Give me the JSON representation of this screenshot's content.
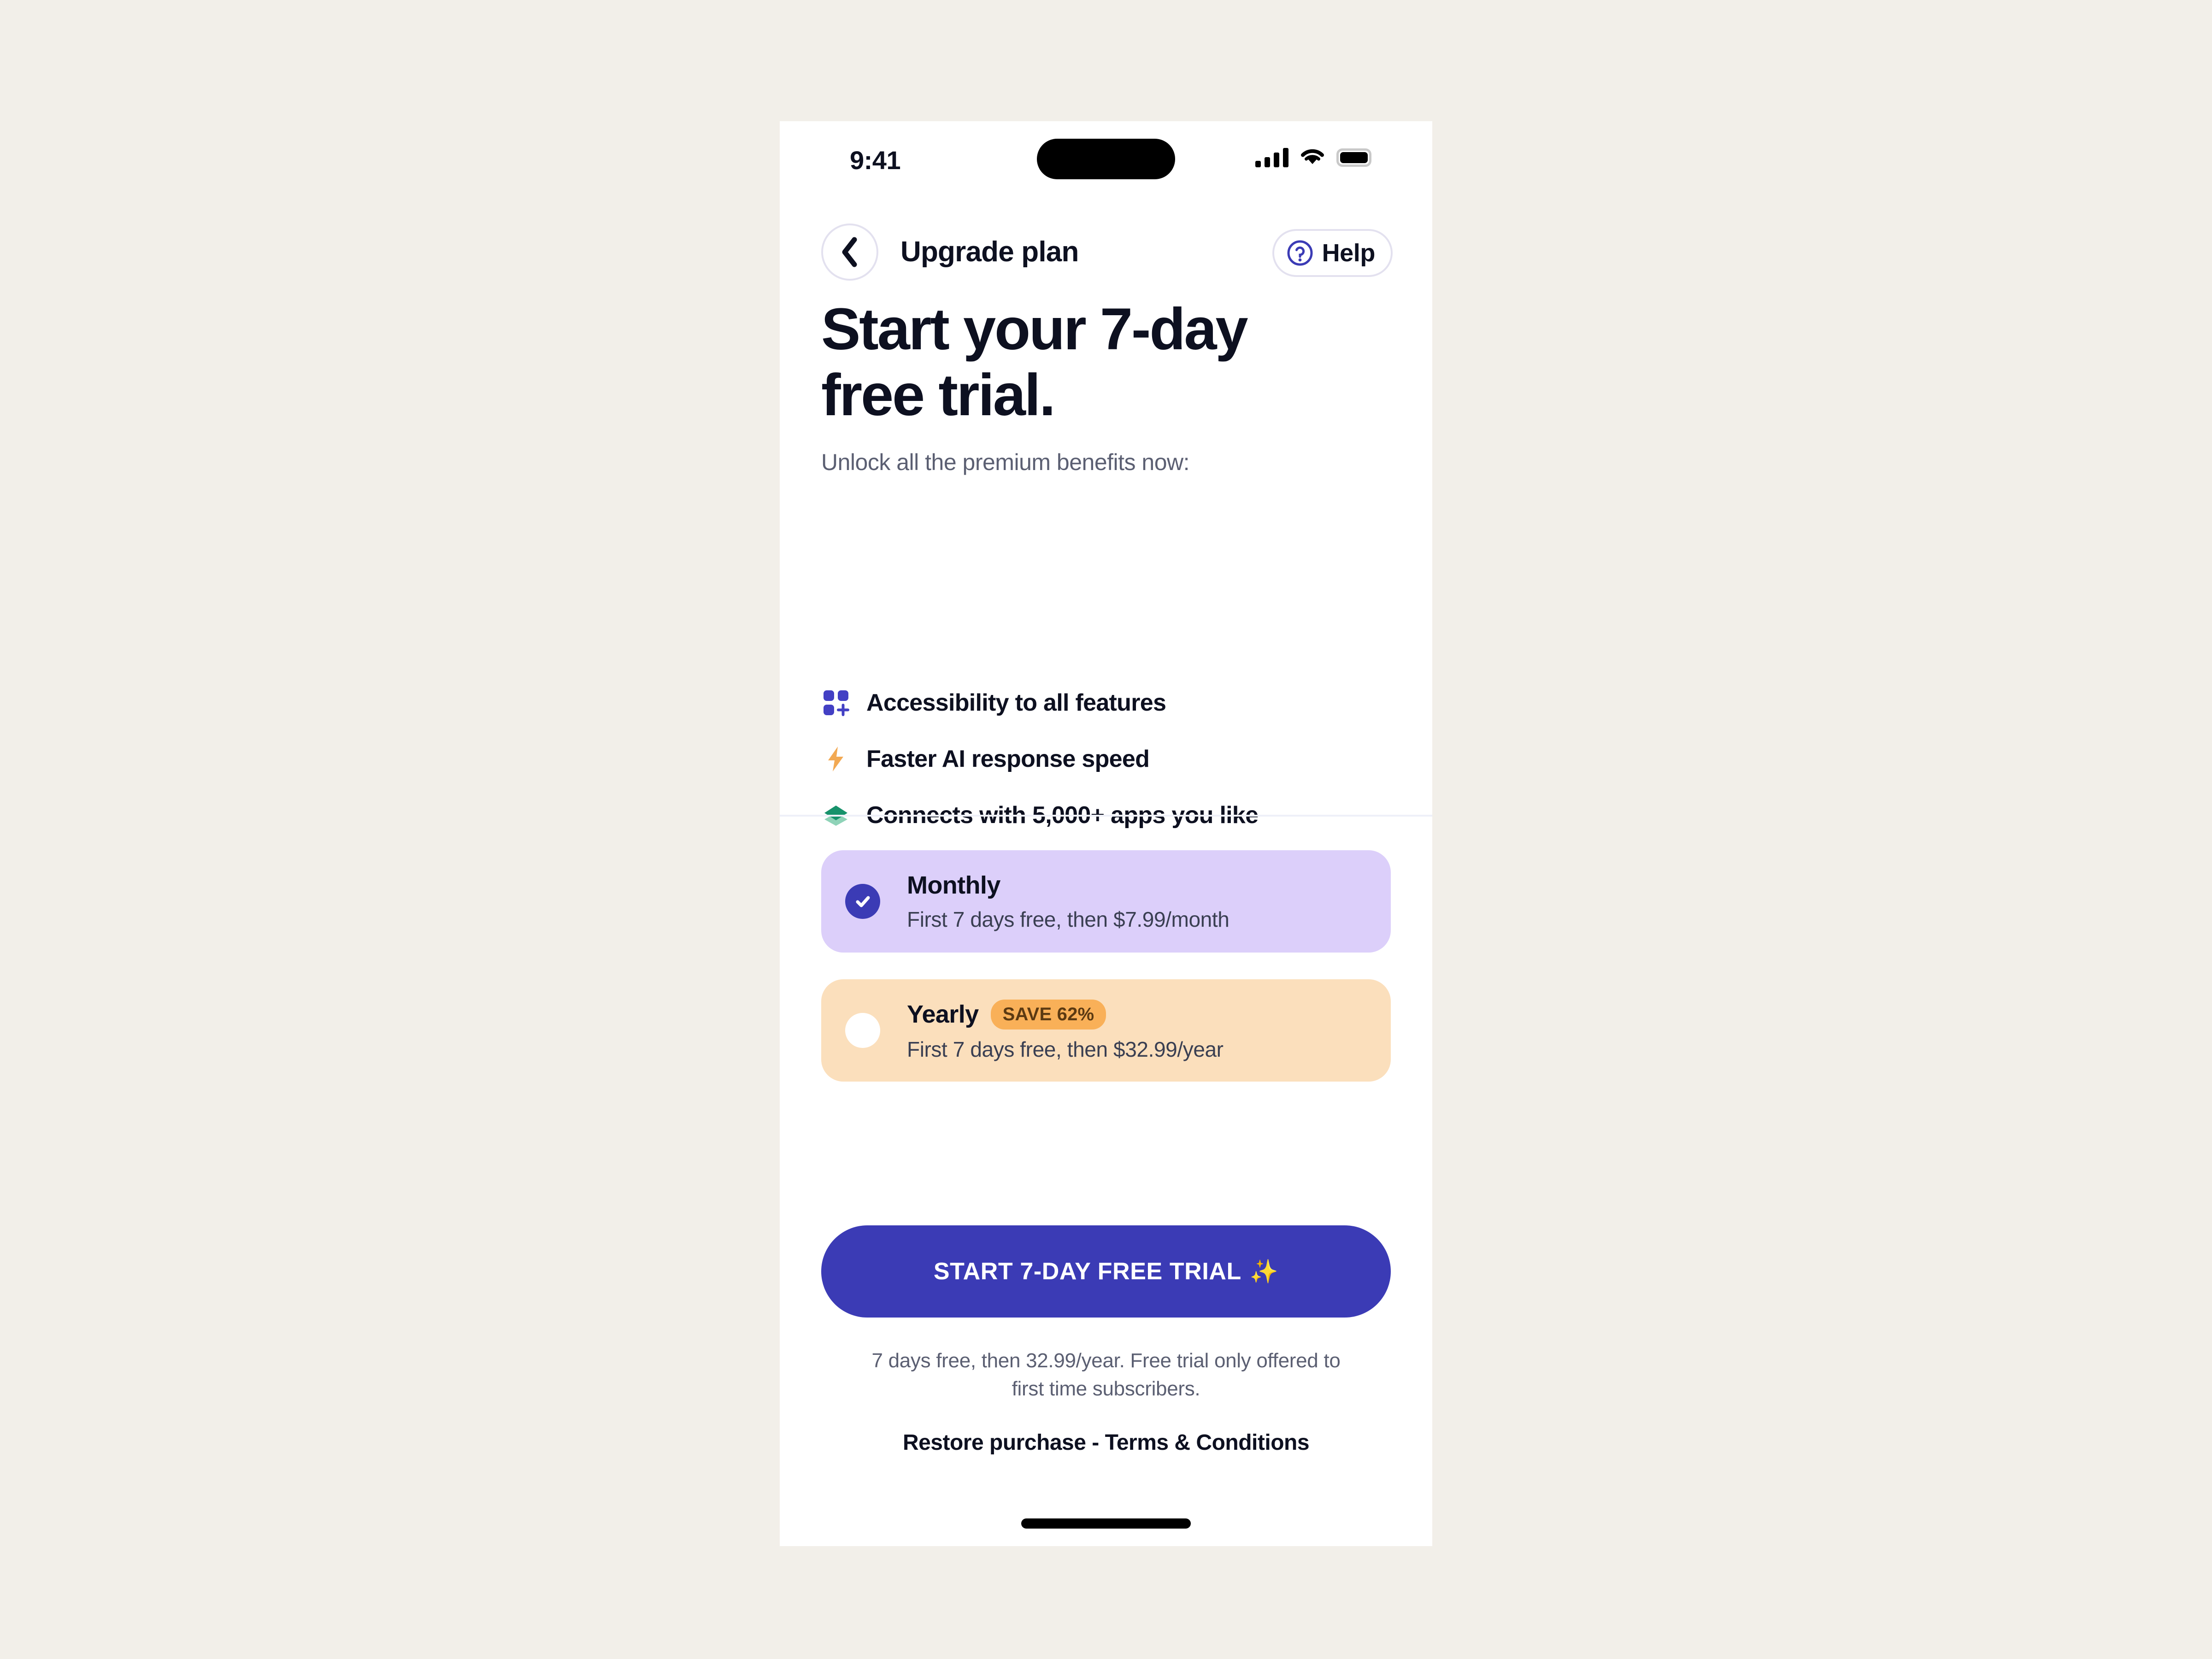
{
  "status_bar": {
    "time": "9:41",
    "cellular_icon": "cellular-bars-icon",
    "wifi_icon": "wifi-icon",
    "battery_icon": "battery-full-icon"
  },
  "header": {
    "back_icon": "chevron-left-icon",
    "title": "Upgrade plan",
    "help_icon": "question-circle-icon",
    "help_label": "Help"
  },
  "hero": {
    "headline_line1": "Start your 7-day",
    "headline_line2": "free trial.",
    "subhead": "Unlock all the premium benefits now:"
  },
  "benefits": [
    {
      "icon": "grid-plus-icon",
      "label": "Accessibility to all features"
    },
    {
      "icon": "lightning-bolt-icon",
      "label": "Faster AI response speed"
    },
    {
      "icon": "layers-icon",
      "label": "Connects with 5,000+ apps you like"
    }
  ],
  "plans": [
    {
      "id": "monthly",
      "title": "Monthly",
      "subtitle": "First 7 days free, then $7.99/month",
      "selected": true,
      "badge": null
    },
    {
      "id": "yearly",
      "title": "Yearly",
      "subtitle": "First 7 days free, then $32.99/year",
      "selected": false,
      "badge": "SAVE 62%"
    }
  ],
  "cta": {
    "label": "START 7-DAY FREE TRIAL",
    "sparkle": "✨"
  },
  "footer": {
    "fine_print": "7 days free, then 32.99/year. Free trial only offered to first time subscribers.",
    "legal": "Restore purchase - Terms & Conditions"
  },
  "colors": {
    "page_background": "#f2efe9",
    "accent_indigo": "#3b3bb5",
    "monthly_card": "#dccffa",
    "yearly_card": "#fbdfbc",
    "save_badge": "#f9b058",
    "text_primary": "#0d1020",
    "text_muted": "#5b5f72",
    "icon_green": "#17926b",
    "icon_orange": "#f2a953"
  }
}
